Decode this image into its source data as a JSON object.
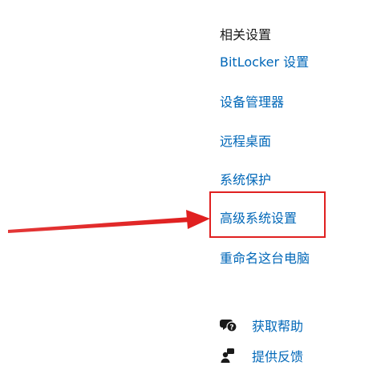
{
  "related_settings": {
    "title": "相关设置",
    "links": {
      "bitlocker": "BitLocker 设置",
      "device_manager": "设备管理器",
      "remote_desktop": "远程桌面",
      "system_protection": "系统保护",
      "advanced_system_settings": "高级系统设置",
      "rename_pc": "重命名这台电脑"
    }
  },
  "help": {
    "get_help": "获取帮助",
    "give_feedback": "提供反馈"
  },
  "colors": {
    "link": "#0067b8",
    "annotation": "#e02020"
  },
  "icons": {
    "get_help": "help-chat-icon",
    "give_feedback": "feedback-person-icon"
  }
}
